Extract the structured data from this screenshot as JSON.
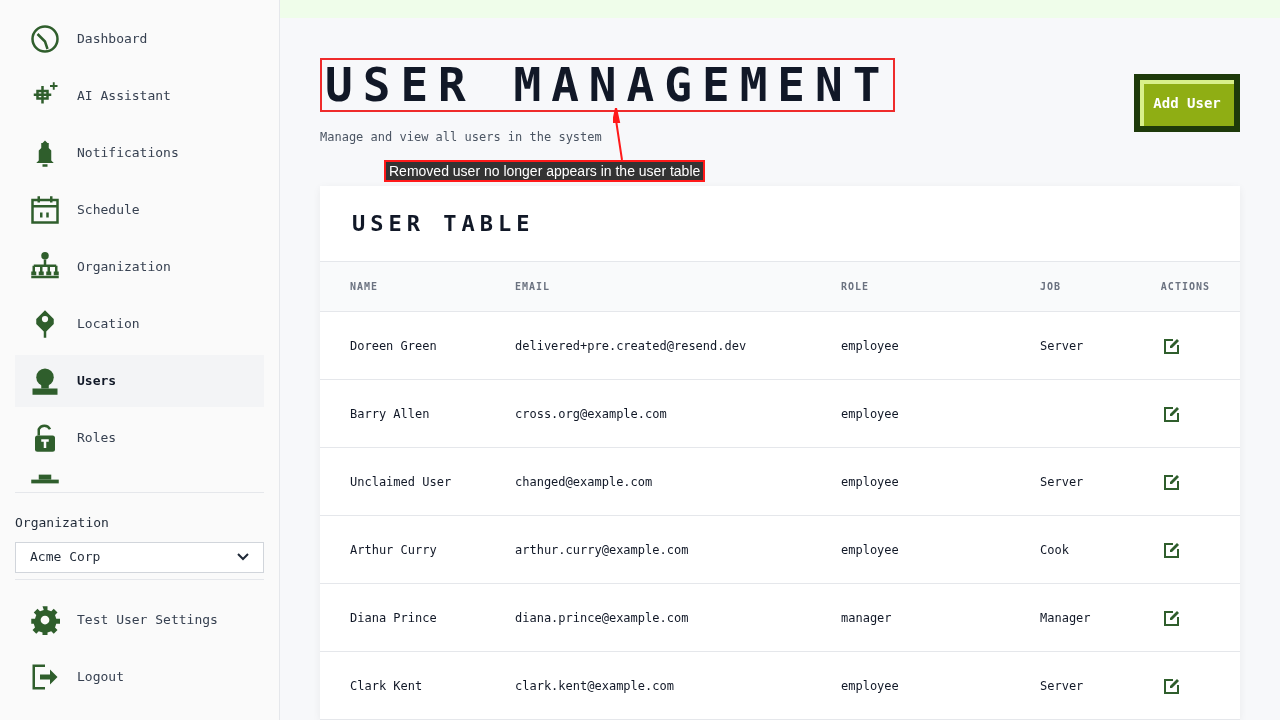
{
  "sidebar": {
    "items": [
      {
        "label": "Dashboard",
        "selected": false
      },
      {
        "label": "AI Assistant",
        "selected": false
      },
      {
        "label": "Notifications",
        "selected": false
      },
      {
        "label": "Schedule",
        "selected": false
      },
      {
        "label": "Organization",
        "selected": false
      },
      {
        "label": "Location",
        "selected": false
      },
      {
        "label": "Users",
        "selected": true
      },
      {
        "label": "Roles",
        "selected": false
      }
    ],
    "organization": {
      "label": "Organization",
      "value": "Acme Corp"
    },
    "footer_items": [
      {
        "label": "Test User Settings"
      },
      {
        "label": "Logout"
      }
    ]
  },
  "header": {
    "title": "USER MANAGEMENT",
    "subtitle": "Manage and view all users in the system",
    "button": "Add User"
  },
  "annotation": {
    "text": "Removed user no longer appears in the user table"
  },
  "table": {
    "title": "USER TABLE",
    "columns": [
      "NAME",
      "EMAIL",
      "ROLE",
      "JOB",
      "ACTIONS"
    ],
    "rows": [
      {
        "name": "Doreen Green",
        "email": "delivered+pre.created@resend.dev",
        "role": "employee",
        "job": "Server"
      },
      {
        "name": "Barry Allen",
        "email": "cross.org@example.com",
        "role": "employee"
      },
      {
        "name": "Unclaimed User",
        "email": "changed@example.com",
        "role": "employee",
        "job": "Server"
      },
      {
        "name": "Arthur Curry",
        "email": "arthur.curry@example.com",
        "role": "employee",
        "job": "Cook"
      },
      {
        "name": "Diana Prince",
        "email": "diana.prince@example.com",
        "role": "manager",
        "job": "Manager"
      },
      {
        "name": "Clark Kent",
        "email": "clark.kent@example.com",
        "role": "employee",
        "job": "Server"
      }
    ]
  }
}
